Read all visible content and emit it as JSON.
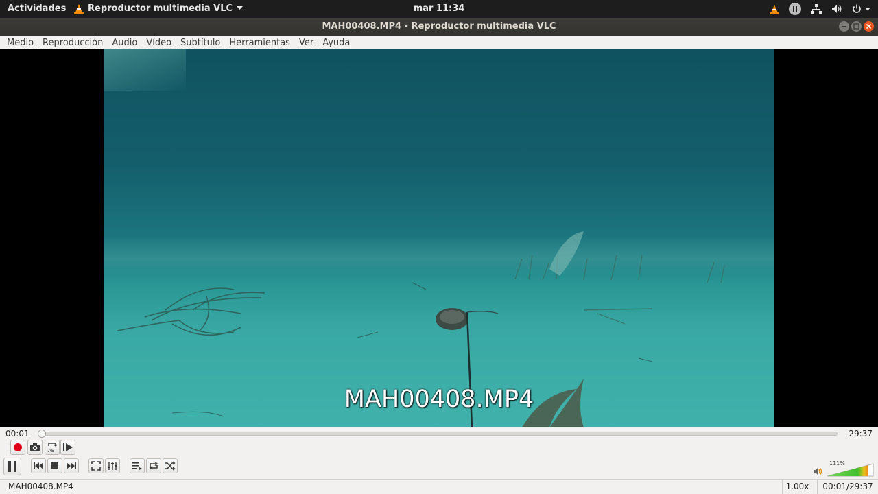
{
  "topbar": {
    "activities": "Actividades",
    "app_menu": "Reproductor multimedia VLC",
    "clock": "mar 11:34"
  },
  "window": {
    "title": "MAH00408.MP4 - Reproductor multimedia VLC"
  },
  "menubar": {
    "items": [
      "Medio",
      "Reproducción",
      "Audio",
      "Vídeo",
      "Subtítulo",
      "Herramientas",
      "Ver",
      "Ayuda"
    ]
  },
  "video": {
    "osd_title": "MAH00408.MP4"
  },
  "playback": {
    "elapsed": "00:01",
    "total": "29:37",
    "progress_fraction": 0.001
  },
  "volume": {
    "percent_label": "111%",
    "level_fraction": 1.11
  },
  "statusbar": {
    "filename": "MAH00408.MP4",
    "speed": "1.00x",
    "time": "00:01/29:37"
  },
  "icons": {
    "record": "record-icon",
    "snapshot": "camera-icon",
    "loop_ab": "loop-ab-icon",
    "frame_step": "frame-step-icon",
    "pause": "pause-icon",
    "previous": "previous-icon",
    "stop": "stop-icon",
    "next": "next-icon",
    "fullscreen": "fullscreen-icon",
    "extended": "equalizer-icon",
    "playlist": "playlist-icon",
    "loop": "loop-icon",
    "shuffle": "shuffle-icon",
    "speaker": "speaker-icon"
  },
  "colors": {
    "record": "#e3001b",
    "vlc_orange": "#f48a00",
    "close_button": "#e9541f",
    "volume_green": "#4cc52a"
  }
}
